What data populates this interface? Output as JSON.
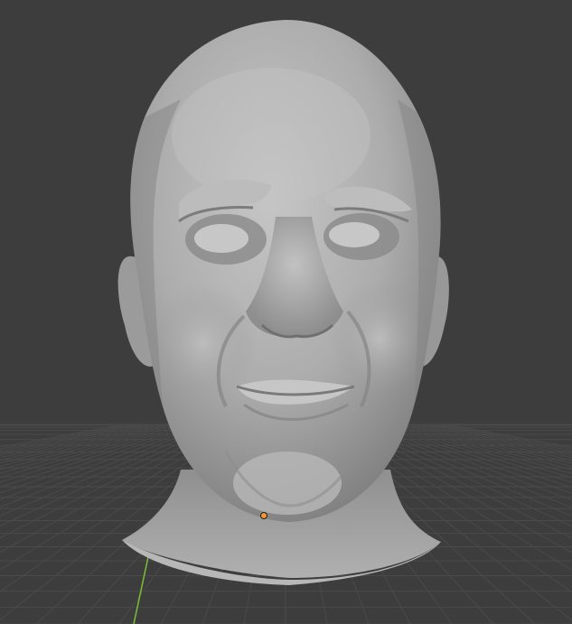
{
  "viewport": {
    "background": "#3d3d3d",
    "grid_color": "#4a4a4a",
    "y_axis_color": "#7bbf36",
    "origin_marker_color": "#f29a2e"
  },
  "model": {
    "subject": "sculpted-head",
    "base_color": "#a9a9a9",
    "shadow_color": "#6e6e6e",
    "highlight_color": "#c4c4c4"
  }
}
